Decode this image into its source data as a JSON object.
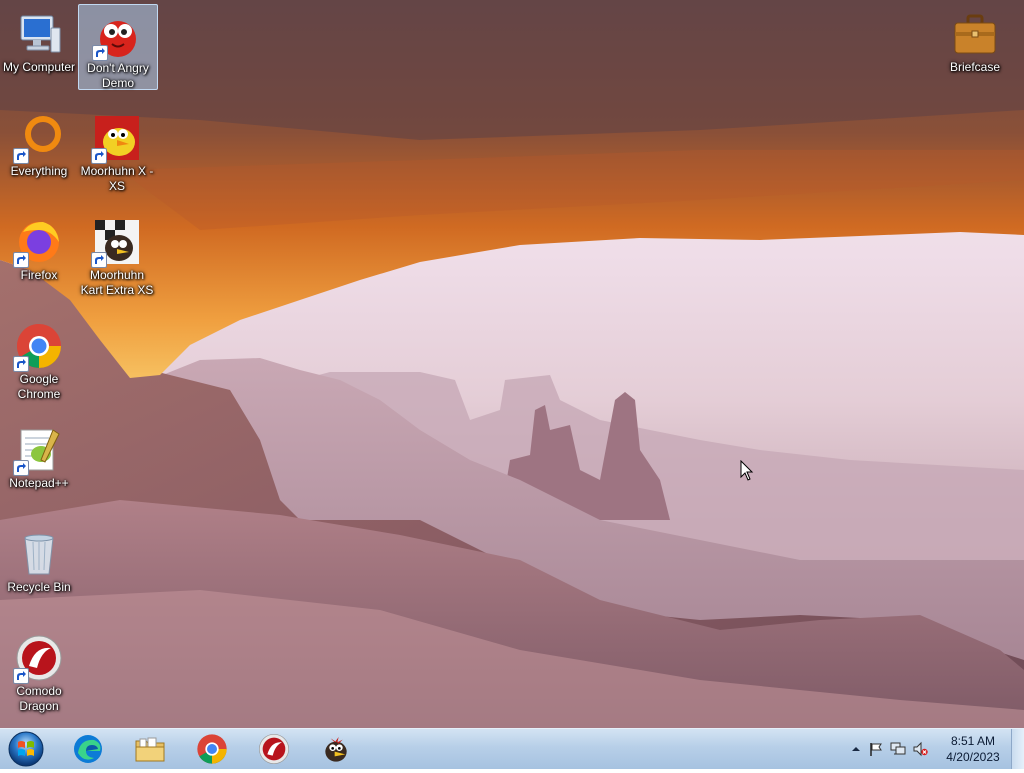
{
  "desktop": {
    "icons": [
      {
        "label": "My Computer",
        "icon": "computer-icon"
      },
      {
        "label": "Don't Angry Demo",
        "icon": "red-bird-icon"
      },
      {
        "label": "Everything",
        "icon": "everything-ring-icon"
      },
      {
        "label": "Moorhuhn X - XS",
        "icon": "moorhuhn-icon"
      },
      {
        "label": "Firefox",
        "icon": "firefox-icon"
      },
      {
        "label": "Moorhuhn Kart Extra XS",
        "icon": "moorhuhn-kart-icon"
      },
      {
        "label": "Google Chrome",
        "icon": "chrome-icon"
      },
      {
        "label": "Notepad++",
        "icon": "notepadpp-icon"
      },
      {
        "label": "Recycle Bin",
        "icon": "recycle-bin-icon"
      },
      {
        "label": "Comodo Dragon",
        "icon": "comodo-dragon-icon"
      },
      {
        "label": "Briefcase",
        "icon": "briefcase-icon"
      }
    ]
  },
  "taskbar": {
    "start": {
      "icon": "windows-start-icon"
    },
    "pinned": [
      {
        "name": "Microsoft Edge",
        "icon": "edge-icon"
      },
      {
        "name": "File Explorer",
        "icon": "folder-icon"
      },
      {
        "name": "Google Chrome",
        "icon": "chrome-icon"
      },
      {
        "name": "Comodo Dragon",
        "icon": "comodo-dragon-icon"
      },
      {
        "name": "Moorhuhn",
        "icon": "moorhuhn-icon"
      }
    ],
    "tray": {
      "icons": [
        "show-hidden-icons-chevron",
        "action-center-flag-icon",
        "network-icon",
        "volume-muted-icon"
      ],
      "time": "8:51 AM",
      "date": "4/20/2023"
    }
  },
  "colors": {
    "taskbar_top": "#d3e3f3",
    "taskbar_bottom": "#a6c2e0",
    "selection": "#add0f0"
  }
}
